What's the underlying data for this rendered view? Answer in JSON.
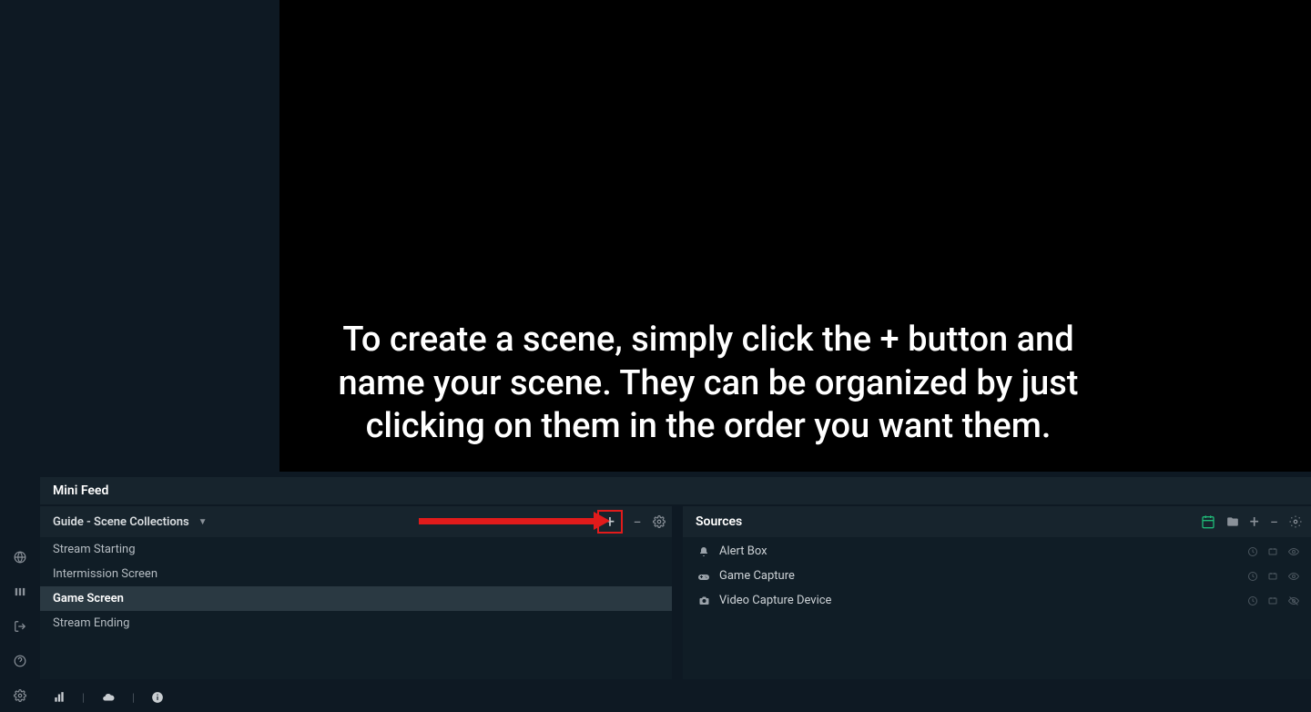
{
  "tutorial": {
    "text": "To create a scene, simply click the + button and name your scene. They can be organized by just clicking on them in the order you want them."
  },
  "mini_feed": {
    "label": "Mini Feed"
  },
  "scenes": {
    "collection_label": "Guide - Scene Collections",
    "items": [
      {
        "label": "Stream Starting",
        "active": false
      },
      {
        "label": "Intermission Screen",
        "active": false
      },
      {
        "label": "Game Screen",
        "active": true
      },
      {
        "label": "Stream Ending",
        "active": false
      }
    ]
  },
  "sources": {
    "title": "Sources",
    "items": [
      {
        "label": "Alert Box",
        "icon": "bell"
      },
      {
        "label": "Game Capture",
        "icon": "gamepad"
      },
      {
        "label": "Video Capture Device",
        "icon": "camera"
      }
    ]
  },
  "annotations": {
    "highlight_color": "#e11b1b"
  }
}
